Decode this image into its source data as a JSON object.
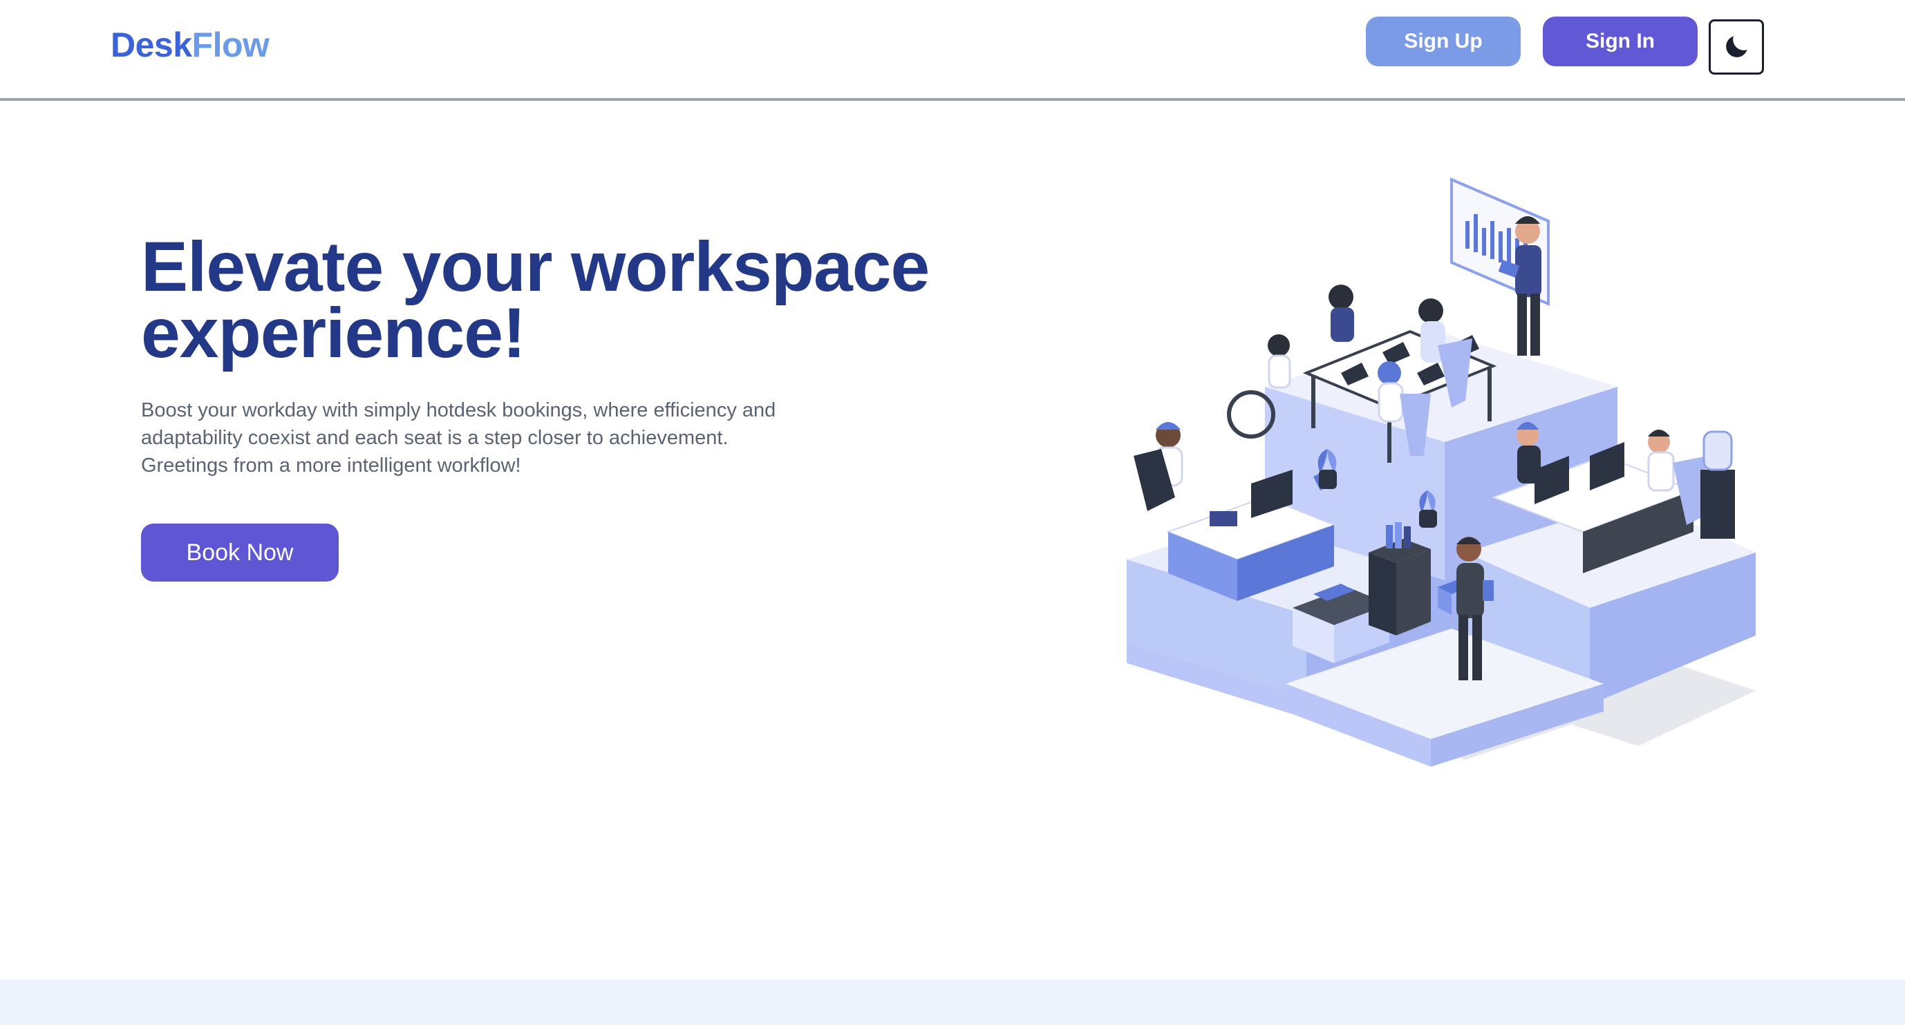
{
  "brand": {
    "name_part1": "Desk",
    "name_part2": "Flow"
  },
  "nav": {
    "signup_label": "Sign Up",
    "signin_label": "Sign In",
    "theme_icon": "moon-icon"
  },
  "hero": {
    "title": "Elevate your workspace experience!",
    "description": "Boost your workday with simply hotdesk bookings, where efficiency and adaptability coexist and each seat is a step closer to achievement. Greetings from a more intelligent workflow!",
    "cta_label": "Book Now"
  },
  "colors": {
    "primary": "#5f56d3",
    "secondary": "#7b9be6",
    "heading": "#233886",
    "logo_dark": "#3a62d9",
    "logo_light": "#6b9ae8",
    "band": "#eef2fc"
  }
}
